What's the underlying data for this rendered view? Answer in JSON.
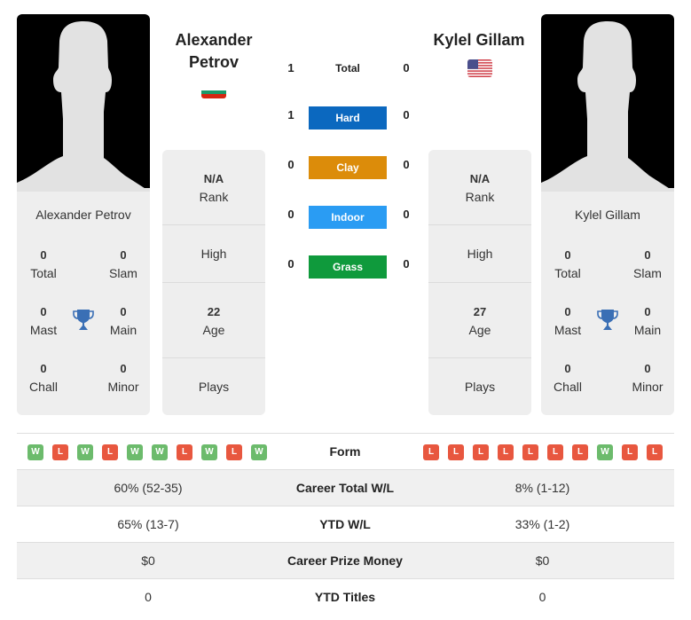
{
  "colors": {
    "win": "#6cbb6c",
    "loss": "#e8573f",
    "hard": "#0b68bf",
    "clay": "#dc8c0a",
    "indoor": "#2a9cf3",
    "grass": "#0f9a3c",
    "trophy": "#3a6fb5",
    "panel_bg": "#eeeeee"
  },
  "player1": {
    "name_header_line1": "Alexander",
    "name_header_line2": "Petrov",
    "card_name": "Alexander Petrov",
    "flag": "bulgaria-flag",
    "titles": {
      "total": {
        "value": "0",
        "label": "Total"
      },
      "slam": {
        "value": "0",
        "label": "Slam"
      },
      "mast": {
        "value": "0",
        "label": "Mast"
      },
      "main": {
        "value": "0",
        "label": "Main"
      },
      "chall": {
        "value": "0",
        "label": "Chall"
      },
      "minor": {
        "value": "0",
        "label": "Minor"
      }
    },
    "info": {
      "rank_value": "N/A",
      "rank_label": "Rank",
      "high_label": "High",
      "age_value": "22",
      "age_label": "Age",
      "plays_label": "Plays"
    },
    "form": [
      "W",
      "L",
      "W",
      "L",
      "W",
      "W",
      "L",
      "W",
      "L",
      "W"
    ],
    "career_total_wl": "60% (52-35)",
    "ytd_wl": "65% (13-7)",
    "career_prize_money": "$0",
    "ytd_titles": "0"
  },
  "player2": {
    "name_header": "Kylel Gillam",
    "card_name": "Kylel Gillam",
    "flag": "usa-flag",
    "titles": {
      "total": {
        "value": "0",
        "label": "Total"
      },
      "slam": {
        "value": "0",
        "label": "Slam"
      },
      "mast": {
        "value": "0",
        "label": "Mast"
      },
      "main": {
        "value": "0",
        "label": "Main"
      },
      "chall": {
        "value": "0",
        "label": "Chall"
      },
      "minor": {
        "value": "0",
        "label": "Minor"
      }
    },
    "info": {
      "rank_value": "N/A",
      "rank_label": "Rank",
      "high_label": "High",
      "age_value": "27",
      "age_label": "Age",
      "plays_label": "Plays"
    },
    "form": [
      "L",
      "L",
      "L",
      "L",
      "L",
      "L",
      "L",
      "W",
      "L",
      "L"
    ],
    "career_total_wl": "8% (1-12)",
    "ytd_wl": "33% (1-2)",
    "career_prize_money": "$0",
    "ytd_titles": "0"
  },
  "h2h": [
    {
      "label": "Total",
      "p1": "1",
      "p2": "0"
    },
    {
      "label": "Hard",
      "p1": "1",
      "p2": "0"
    },
    {
      "label": "Clay",
      "p1": "0",
      "p2": "0"
    },
    {
      "label": "Indoor",
      "p1": "0",
      "p2": "0"
    },
    {
      "label": "Grass",
      "p1": "0",
      "p2": "0"
    }
  ],
  "table_labels": {
    "form": "Form",
    "career_total_wl": "Career Total W/L",
    "ytd_wl": "YTD W/L",
    "career_prize_money": "Career Prize Money",
    "ytd_titles": "YTD Titles"
  }
}
